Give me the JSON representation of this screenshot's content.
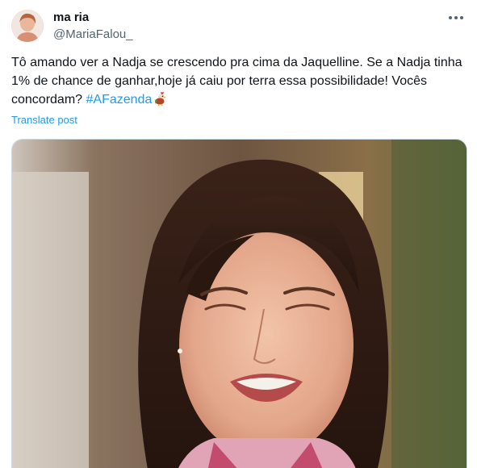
{
  "author": {
    "display_name": "ma ria",
    "handle": "@MariaFalou_"
  },
  "tweet": {
    "text_before_hashtag": "Tô amando ver a Nadja se crescendo pra cima da Jaquelline. Se a Nadja tinha 1% de chance de ganhar,hoje já caiu por terra essa possibilidade! Vocês concordam? ",
    "hashtag": "#AFazenda",
    "emoji_icon": "rooster-emoji-icon",
    "translate_label": "Translate post"
  },
  "media": {
    "kind": "photo"
  },
  "colors": {
    "link": "#1d9bf0",
    "text": "#0f1419",
    "secondary": "#536471"
  }
}
